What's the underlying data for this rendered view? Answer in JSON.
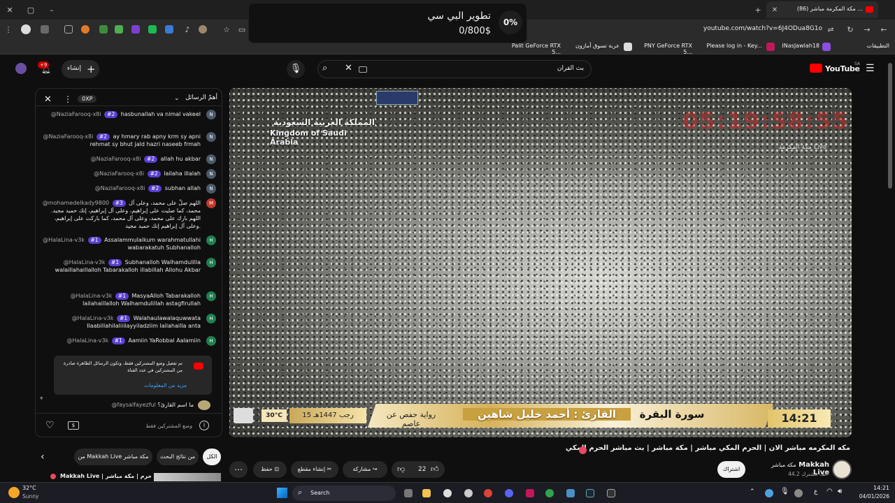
{
  "browser": {
    "tab_title": "(86) مكة المكرمة مباشر ...",
    "url": "youtube.com/watch?v=6J4ODua8G1o",
    "bookmarks": [
      "التطبيقات",
      "INasJawlah18",
      "Please log in - Key...",
      "PNY GeForce RTX 5...",
      "عربة تسوق أمازون",
      "Palit GeForce RTX 5..."
    ]
  },
  "popup": {
    "title": "تطوير البي سي",
    "amount": "0/800$",
    "percent": "0%"
  },
  "youtube": {
    "logo": "YouTube",
    "logo_region": "SA",
    "search_value": "بث القران",
    "create_label": "إنشاء",
    "notif_count": "+9"
  },
  "chat": {
    "header_label": "أهمّ الرسائل",
    "xp_label": "0XP",
    "messages": [
      {
        "user": "@NaziaFarooq-x8i",
        "badge": "#2",
        "text": "hasbunallah va nimal vakeel",
        "avatar": "N",
        "color": "#4a5a6a"
      },
      {
        "user": "@NaziaFarooq-x8i",
        "badge": "#2",
        "text": "ay hmary rab apny krm sy apni rehmat sy bhut jald hazri naseeb frmah",
        "avatar": "N",
        "color": "#4a5a6a"
      },
      {
        "user": "@NaziaFarooq-x8i",
        "badge": "#2",
        "text": "allah hu akbar",
        "avatar": "N",
        "color": "#4a5a6a"
      },
      {
        "user": "@NaziaFarooq-x8i",
        "badge": "#2",
        "text": "lailaha illalah",
        "avatar": "N",
        "color": "#4a5a6a"
      },
      {
        "user": "@NaziaFarooq-x8i",
        "badge": "#2",
        "text": "subhan allah",
        "avatar": "N",
        "color": "#4a5a6a"
      },
      {
        "user": "@mohamedelkady9800",
        "badge": "#3",
        "text": "اللهم صلّ على محمد، وعلى آل محمد، كما صليت على إبراهيم، وعلى آل إبراهيم، إنك حميد مجيد. اللهم بارك على محمد، وعلى آل محمد، كما باركت على إبراهيم، وعلى آل إبراهيم إنك حميد مجيد.",
        "avatar": "M",
        "color": "#c0392b"
      },
      {
        "user": "@HalaLina-v3k",
        "badge": "#1",
        "text": "Assalammulaikum warahmatullahi wabarakatuh Subhanalloh",
        "avatar": "H",
        "color": "#1e7f4f"
      },
      {
        "user": "@HalaLina-v3k",
        "badge": "#1",
        "text": "Subhanalloh Walhamdulilla walaillahaillalloh Tabarakalloh illabillah Allohu Akbar",
        "avatar": "H",
        "color": "#1e7f4f"
      },
      {
        "user": "@HalaLina-v3k",
        "badge": "#1",
        "text": "MasyaAlloh Tabarakalloh lailahaillalloh Walhamdulillah astagfirullah",
        "avatar": "H",
        "color": "#1e7f4f"
      },
      {
        "user": "@HalaLina-v3k",
        "badge": "#1",
        "text": "Walahaulawalaquwwata Ilaabillahilaliiilayyiladziim lailahailla anta",
        "avatar": "H",
        "color": "#1e7f4f"
      },
      {
        "user": "@HalaLina-v3k",
        "badge": "#1",
        "text": "Aamiin YaRobbal Aalamiin",
        "avatar": "H",
        "color": "#1e7f4f"
      }
    ],
    "notice": {
      "text": "تم تفعيل وضع المشتركين فقط، وتكون الرسائل الظاهرة صادرة من المشتركين في عدد القناة",
      "link": "مزيد من المعلومات"
    },
    "last_message": {
      "user": "@faysalfayezful",
      "text": "ما اسم القارئ؟"
    },
    "input_placeholder": "وضع المشتركين فقط"
  },
  "video": {
    "kingdom_ar": "المملكة العربية السعودية",
    "kingdom_en": "Kingdom of Saudi Arabia",
    "clock": "05:19:58:55",
    "channel_watermark": "مكة المكرمة Live",
    "lower_third": {
      "surah": "سورة البقرة",
      "reciter": "القارئ : أحمد خليل شاهين",
      "riwaya": "رواية حفص عن عاصم",
      "date": "15 رجب 1447هـ",
      "temp": "30°C",
      "time": "14:21"
    }
  },
  "below": {
    "title": "مكه المكرمه مباشر الان | الحرم المكي مباشر | مكة مباشر | بث مباشر الحرم المكي",
    "channel": "Makkah Live",
    "channel_sub": "مكة مباشر",
    "subscribers": "44.2 ألف مشترك",
    "subscribe_label": "اشتراك",
    "likes": "22",
    "share": "مشاركة",
    "clip": "إنشاء مقطع",
    "save": "حفظ",
    "chips": [
      "الكل",
      "من نتائج البحث",
      "من Makkah Live مكة مباشر"
    ],
    "rec_title": "Makkah Live | الحرم | مكة مباشر"
  },
  "taskbar": {
    "weather_temp": "32°C",
    "weather_desc": "Sunny",
    "search": "Search",
    "time": "14:21",
    "date": "04/01/2026",
    "lang": "ع"
  }
}
